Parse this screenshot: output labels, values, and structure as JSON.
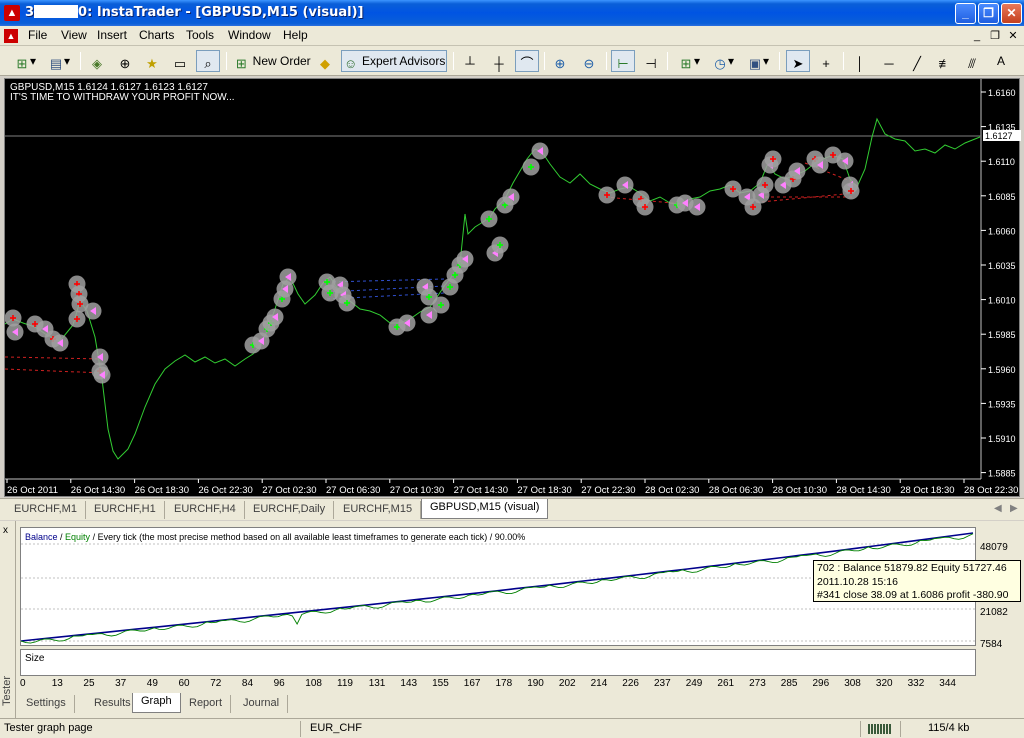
{
  "window": {
    "title_prefix": "3",
    "title_suffix": "0: InstaTrader - [GBPUSD,M15 (visual)]",
    "app_icon": "instatrader-logo-icon"
  },
  "menu": {
    "items": [
      "File",
      "View",
      "Insert",
      "Charts",
      "Tools",
      "Window",
      "Help"
    ]
  },
  "toolbar": {
    "new_order": "New Order",
    "expert_advisors": "Expert Advisors",
    "text_tool": "A"
  },
  "chart": {
    "symbol_line": "GBPUSD,M15  1.6124 1.6127 1.6123 1.6127",
    "message": "IT'S TIME TO WITHDRAW YOUR PROFIT NOW...",
    "current_price": "1.6127",
    "price_ticks": [
      "1.6160",
      "1.6135",
      "1.6110",
      "1.6085",
      "1.6060",
      "1.6035",
      "1.6010",
      "1.5985",
      "1.5960",
      "1.5935",
      "1.5910",
      "1.5885"
    ],
    "time_ticks": [
      "26 Oct 2011",
      "26 Oct 14:30",
      "26 Oct 18:30",
      "26 Oct 22:30",
      "27 Oct 02:30",
      "27 Oct 06:30",
      "27 Oct 10:30",
      "27 Oct 14:30",
      "27 Oct 18:30",
      "27 Oct 22:30",
      "28 Oct 02:30",
      "28 Oct 06:30",
      "28 Oct 10:30",
      "28 Oct 14:30",
      "28 Oct 18:30",
      "28 Oct 22:30"
    ],
    "colors": {
      "background": "#000000",
      "line": "#32cd32",
      "grid_label": "#ffffff",
      "sell_marker": "#ff0000",
      "buy_marker": "#00ff00",
      "halo": "#a0a0a0"
    }
  },
  "chart_tabs": [
    "EURCHF,M1",
    "EURCHF,H1",
    "EURCHF,H4",
    "EURCHF,Daily",
    "EURCHF,M15",
    "GBPUSD,M15 (visual)"
  ],
  "tester": {
    "side_label": "Tester",
    "close_label": "x",
    "graph": {
      "legend_balance": "Balance",
      "legend_slash": " / ",
      "legend_equity": "Equity",
      "legend_rest": " / Every tick (the most precise method based on all available least timeframes to generate each tick) / 90.00%",
      "y_labels": [
        "48079",
        "34581",
        "21082",
        "7584"
      ],
      "x_labels": [
        "0",
        "13",
        "25",
        "37",
        "49",
        "60",
        "72",
        "84",
        "96",
        "108",
        "119",
        "131",
        "143",
        "155",
        "167",
        "178",
        "190",
        "202",
        "214",
        "226",
        "237",
        "249",
        "261",
        "273",
        "285",
        "296",
        "308",
        "320",
        "332",
        "344"
      ],
      "size_label": "Size",
      "tooltip_line1": "702 : Balance 51879.82 Equity 51727.46",
      "tooltip_line2": "2011.10.28 15:16",
      "tooltip_line3": "#341 close 38.09 at 1.6086 profit -380.90",
      "balance_color": "#00008b",
      "equity_color": "#008000"
    },
    "tabs": [
      "Settings",
      "Results",
      "Graph",
      "Report",
      "Journal"
    ]
  },
  "status": {
    "left": "Tester graph page",
    "symbol": "EUR_CHF",
    "traffic": "115/4 kb"
  }
}
